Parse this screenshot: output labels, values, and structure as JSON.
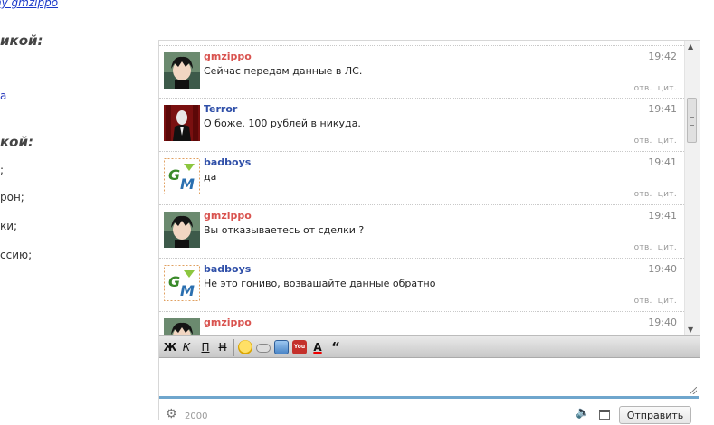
{
  "page_fragments": {
    "link": "ny gmzippo",
    "heading1": "икой:",
    "link2": "а",
    "heading2": "кой:",
    "line1": ";",
    "line2": "рон;",
    "line3": "ки;",
    "line4": "ссию;"
  },
  "chat": {
    "actions": {
      "reply": "отв.",
      "quote": "цит."
    },
    "messages": [
      {
        "user": "gmzippo",
        "user_color": "#d9534f",
        "avatar": "anime-avatar",
        "text": "Сейчас передам данные в ЛС.",
        "time": "19:42"
      },
      {
        "user": "Terror",
        "user_color": "#2f4fa8",
        "avatar": "slender-avatar",
        "text": "О боже. 100 рублей в никуда.",
        "time": "19:41"
      },
      {
        "user": "badboys",
        "user_color": "#2f4fa8",
        "avatar": "gm-logo-avatar",
        "text": "да",
        "time": "19:41"
      },
      {
        "user": "gmzippo",
        "user_color": "#d9534f",
        "avatar": "anime-avatar",
        "text": "Вы отказываетесь от сделки ?",
        "time": "19:41"
      },
      {
        "user": "badboys",
        "user_color": "#2f4fa8",
        "avatar": "gm-logo-avatar",
        "text": "Не это гониво, возвашайте данные обратно",
        "time": "19:40"
      },
      {
        "user": "gmzippo",
        "user_color": "#d9534f",
        "avatar": "anime-avatar",
        "text": "",
        "time": "19:40"
      }
    ]
  },
  "toolbar": {
    "bold": "Ж",
    "italic": "К",
    "underline": "П",
    "strike": "Н",
    "quote": "“"
  },
  "footer": {
    "counter": "2000",
    "send_label": "Отправить"
  }
}
